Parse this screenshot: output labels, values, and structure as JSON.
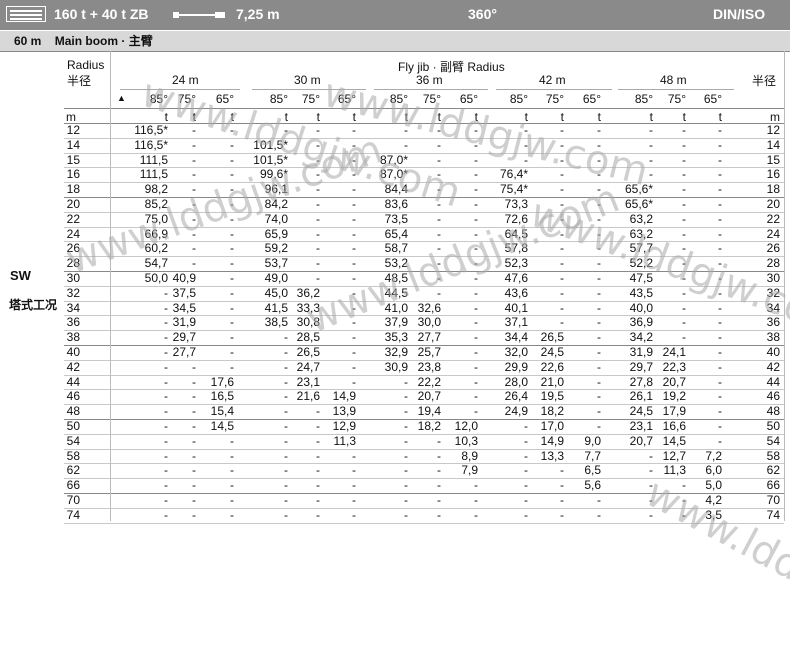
{
  "header": {
    "loads": "160 t + 40 t ZB",
    "jib_length": "7,25 m",
    "slewing": "360°",
    "standard": "DIN/ISO"
  },
  "subheader": {
    "boom": "60 m",
    "label": "Main boom · 主臂"
  },
  "side_label": {
    "code": "SW",
    "text": "塔式工况"
  },
  "table_header": {
    "radius_en": "Radius",
    "radius_cn": "半径",
    "flyjib": "Fly jib · 副臂 Radius",
    "radius_cn_right": "半径",
    "jib_lengths": [
      "24 m",
      "30 m",
      "36 m",
      "42 m",
      "48 m"
    ],
    "angles": [
      "85°",
      "75°",
      "65°",
      "85°",
      "75°",
      "65°",
      "85°",
      "75°",
      "65°",
      "85°",
      "75°",
      "65°",
      "85°",
      "75°",
      "65°"
    ],
    "units": [
      "m",
      "t",
      "t",
      "t",
      "t",
      "t",
      "t",
      "t",
      "t",
      "t",
      "t",
      "t",
      "t",
      "t",
      "t",
      "t",
      "m"
    ]
  },
  "rows": [
    {
      "r": "12",
      "v": [
        "116,5*",
        "-",
        "-",
        "-",
        "-",
        "-",
        "-",
        "-",
        "-",
        "-",
        "-",
        "-",
        "-",
        "-",
        "-"
      ]
    },
    {
      "r": "14",
      "v": [
        "116,5*",
        "-",
        "-",
        "101,5*",
        "-",
        "-",
        "-",
        "-",
        "-",
        "-",
        "-",
        "-",
        "-",
        "-",
        "-"
      ]
    },
    {
      "r": "15",
      "v": [
        "111,5",
        "-",
        "-",
        "101,5*",
        "-",
        "-",
        "87,0*",
        "-",
        "-",
        "-",
        "-",
        "-",
        "-",
        "-",
        "-"
      ]
    },
    {
      "r": "16",
      "v": [
        "111,5",
        "-",
        "-",
        "99,6*",
        "-",
        "-",
        "87,0*",
        "-",
        "-",
        "76,4*",
        "-",
        "-",
        "-",
        "-",
        "-"
      ]
    },
    {
      "r": "18",
      "v": [
        "98,2",
        "-",
        "-",
        "96,1",
        "-",
        "-",
        "84,4",
        "-",
        "-",
        "75,4*",
        "-",
        "-",
        "65,6*",
        "-",
        "-"
      ]
    },
    {
      "r": "20",
      "v": [
        "85,2",
        "-",
        "-",
        "84,2",
        "-",
        "-",
        "83,6",
        "-",
        "-",
        "73,3",
        "-",
        "-",
        "65,6*",
        "-",
        "-"
      ]
    },
    {
      "r": "22",
      "v": [
        "75,0",
        "-",
        "-",
        "74,0",
        "-",
        "-",
        "73,5",
        "-",
        "-",
        "72,6",
        "-",
        "-",
        "63,2",
        "-",
        "-"
      ]
    },
    {
      "r": "24",
      "v": [
        "66,9",
        "-",
        "-",
        "65,9",
        "-",
        "-",
        "65,4",
        "-",
        "-",
        "64,5",
        "-",
        "-",
        "63,2",
        "-",
        "-"
      ]
    },
    {
      "r": "26",
      "v": [
        "60,2",
        "-",
        "-",
        "59,2",
        "-",
        "-",
        "58,7",
        "-",
        "-",
        "57,8",
        "-",
        "-",
        "57,7",
        "-",
        "-"
      ]
    },
    {
      "r": "28",
      "v": [
        "54,7",
        "-",
        "-",
        "53,7",
        "-",
        "-",
        "53,2",
        "-",
        "-",
        "52,3",
        "-",
        "-",
        "52,2",
        "-",
        "-"
      ]
    },
    {
      "r": "30",
      "v": [
        "50,0",
        "40,9",
        "-",
        "49,0",
        "-",
        "-",
        "48,5",
        "-",
        "-",
        "47,6",
        "-",
        "-",
        "47,5",
        "-",
        "-"
      ]
    },
    {
      "r": "32",
      "v": [
        "-",
        "37,5",
        "-",
        "45,0",
        "36,2",
        "-",
        "44,5",
        "-",
        "-",
        "43,6",
        "-",
        "-",
        "43,5",
        "-",
        "-"
      ]
    },
    {
      "r": "34",
      "v": [
        "-",
        "34,5",
        "-",
        "41,5",
        "33,3",
        "-",
        "41,0",
        "32,6",
        "-",
        "40,1",
        "-",
        "-",
        "40,0",
        "-",
        "-"
      ]
    },
    {
      "r": "36",
      "v": [
        "-",
        "31,9",
        "-",
        "38,5",
        "30,8",
        "-",
        "37,9",
        "30,0",
        "-",
        "37,1",
        "-",
        "-",
        "36,9",
        "-",
        "-"
      ]
    },
    {
      "r": "38",
      "v": [
        "-",
        "29,7",
        "-",
        "-",
        "28,5",
        "-",
        "35,3",
        "27,7",
        "-",
        "34,4",
        "26,5",
        "-",
        "34,2",
        "-",
        "-"
      ]
    },
    {
      "r": "40",
      "v": [
        "-",
        "27,7",
        "-",
        "-",
        "26,5",
        "-",
        "32,9",
        "25,7",
        "-",
        "32,0",
        "24,5",
        "-",
        "31,9",
        "24,1",
        "-"
      ]
    },
    {
      "r": "42",
      "v": [
        "-",
        "-",
        "-",
        "-",
        "24,7",
        "-",
        "30,9",
        "23,8",
        "-",
        "29,9",
        "22,6",
        "-",
        "29,7",
        "22,3",
        "-"
      ]
    },
    {
      "r": "44",
      "v": [
        "-",
        "-",
        "17,6",
        "-",
        "23,1",
        "-",
        "-",
        "22,2",
        "-",
        "28,0",
        "21,0",
        "-",
        "27,8",
        "20,7",
        "-"
      ]
    },
    {
      "r": "46",
      "v": [
        "-",
        "-",
        "16,5",
        "-",
        "21,6",
        "14,9",
        "-",
        "20,7",
        "-",
        "26,4",
        "19,5",
        "-",
        "26,1",
        "19,2",
        "-"
      ]
    },
    {
      "r": "48",
      "v": [
        "-",
        "-",
        "15,4",
        "-",
        "-",
        "13,9",
        "-",
        "19,4",
        "-",
        "24,9",
        "18,2",
        "-",
        "24,5",
        "17,9",
        "-"
      ]
    },
    {
      "r": "50",
      "v": [
        "-",
        "-",
        "14,5",
        "-",
        "-",
        "12,9",
        "-",
        "18,2",
        "12,0",
        "-",
        "17,0",
        "-",
        "23,1",
        "16,6",
        "-"
      ]
    },
    {
      "r": "54",
      "v": [
        "-",
        "-",
        "-",
        "-",
        "-",
        "11,3",
        "-",
        "-",
        "10,3",
        "-",
        "14,9",
        "9,0",
        "20,7",
        "14,5",
        "-"
      ]
    },
    {
      "r": "58",
      "v": [
        "-",
        "-",
        "-",
        "-",
        "-",
        "-",
        "-",
        "-",
        "8,9",
        "-",
        "13,3",
        "7,7",
        "-",
        "12,7",
        "7,2"
      ]
    },
    {
      "r": "62",
      "v": [
        "-",
        "-",
        "-",
        "-",
        "-",
        "-",
        "-",
        "-",
        "7,9",
        "-",
        "-",
        "6,5",
        "-",
        "11,3",
        "6,0"
      ]
    },
    {
      "r": "66",
      "v": [
        "-",
        "-",
        "-",
        "-",
        "-",
        "-",
        "-",
        "-",
        "-",
        "-",
        "-",
        "5,6",
        "-",
        "-",
        "5,0"
      ]
    },
    {
      "r": "70",
      "v": [
        "-",
        "-",
        "-",
        "-",
        "-",
        "-",
        "-",
        "-",
        "-",
        "-",
        "-",
        "-",
        "-",
        "-",
        "4,2"
      ]
    },
    {
      "r": "74",
      "v": [
        "-",
        "-",
        "-",
        "-",
        "-",
        "-",
        "-",
        "-",
        "-",
        "-",
        "-",
        "-",
        "-",
        "-",
        "3,5"
      ]
    }
  ],
  "watermark": "www.lddgjw.com"
}
